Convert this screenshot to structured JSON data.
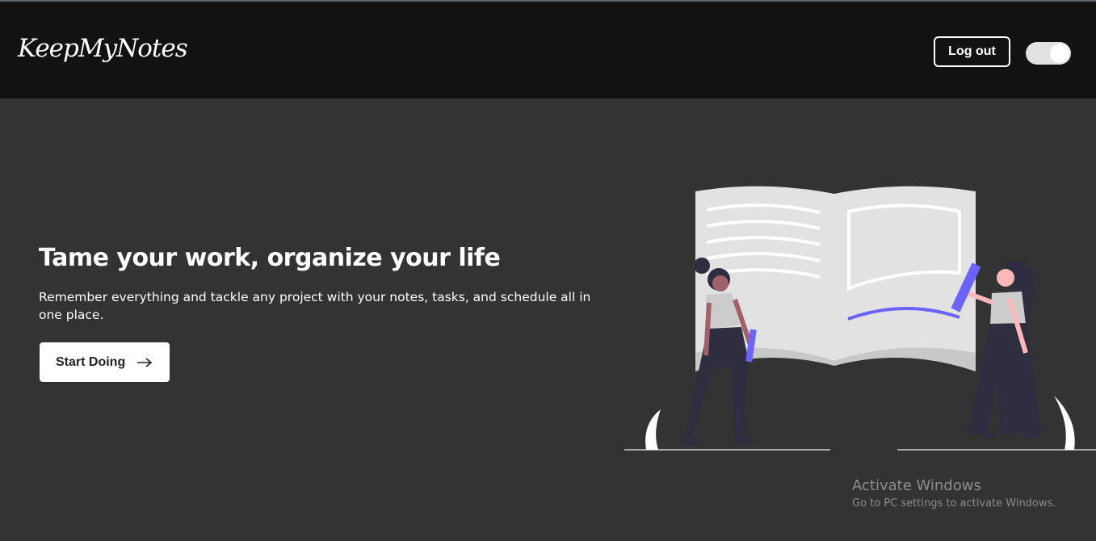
{
  "navbar": {
    "logo": "KeepMyNotes",
    "logout_label": "Log out",
    "theme_toggle": {
      "state": "on"
    }
  },
  "hero": {
    "title": "Tame your work, organize your life",
    "subtitle": "Remember everything and tackle any project with your notes, tasks, and schedule all in one place.",
    "cta_label": "Start Doing",
    "cta_icon": "arrow-right-icon",
    "illustration": "two-people-writing-in-open-book"
  },
  "watermark": {
    "title": "Activate Windows",
    "subtitle": "Go to PC settings to activate Windows."
  },
  "colors": {
    "navbar_bg": "#121212",
    "page_bg": "#333333",
    "accent": "#6c63ff",
    "text": "#ffffff"
  }
}
